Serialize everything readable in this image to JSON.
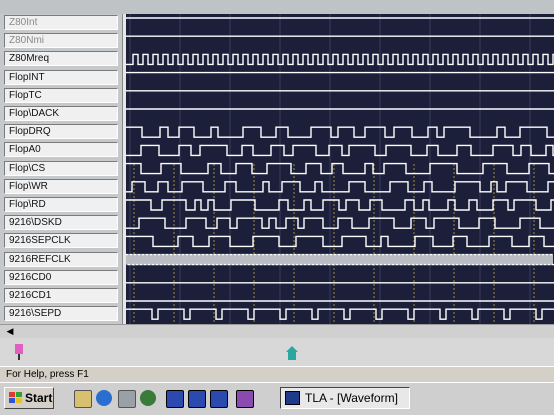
{
  "signals": [
    {
      "label": "Z80Int",
      "dim": true
    },
    {
      "label": "Z80Nmi",
      "dim": true
    },
    {
      "label": "Z80Mreq",
      "dim": false
    },
    {
      "label": "FlopINT",
      "dim": false
    },
    {
      "label": "FlopTC",
      "dim": false
    },
    {
      "label": "Flop\\DACK",
      "dim": false
    },
    {
      "label": "FlopDRQ",
      "dim": false
    },
    {
      "label": "FlopA0",
      "dim": false
    },
    {
      "label": "Flop\\CS",
      "dim": false
    },
    {
      "label": "Flop\\WR",
      "dim": false
    },
    {
      "label": "Flop\\RD",
      "dim": false
    },
    {
      "label": "9216\\DSKD",
      "dim": false
    },
    {
      "label": "9216SEPCLK",
      "dim": false
    },
    {
      "label": "9216REFCLK",
      "dim": false
    },
    {
      "label": "9216CD0",
      "dim": false
    },
    {
      "label": "9216CD1",
      "dim": false
    },
    {
      "label": "9216\\SEPD",
      "dim": false
    }
  ],
  "status": {
    "help_text": "For Help, press F1"
  },
  "taskbar": {
    "start_label": "Start",
    "task_label": "TLA - [Waveform]"
  },
  "icons": {
    "scroll_left": "scroll-left-arrow-icon",
    "marker": "cursor-marker-icon"
  },
  "colors": {
    "waveform_bg": "#1c1f3a",
    "trace": "#ffffff",
    "grid": "#c8a832"
  }
}
